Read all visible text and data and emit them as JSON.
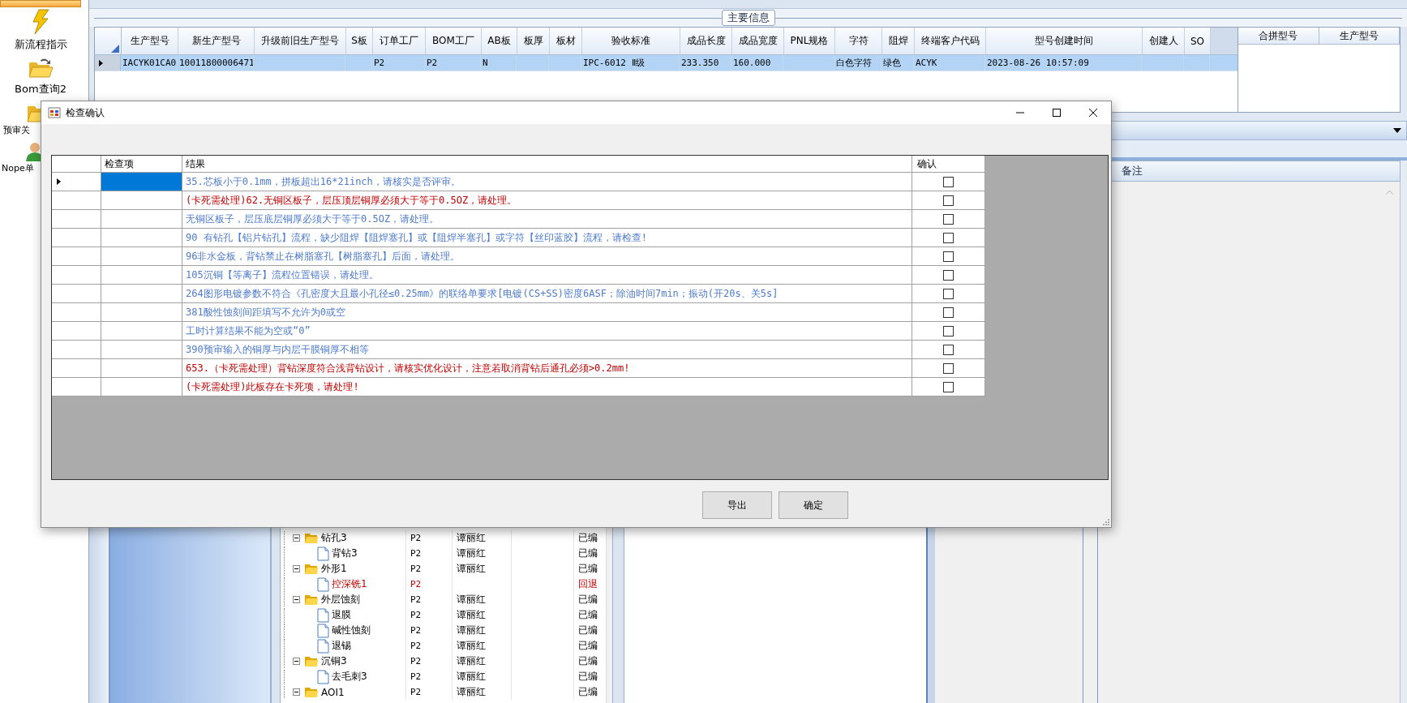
{
  "sidebar": {
    "items": [
      {
        "kind": "lightning",
        "label": "新流程指示"
      },
      {
        "kind": "folder-arrow",
        "label": "Bom查询2"
      },
      {
        "kind": "folder",
        "label": "预审关"
      },
      {
        "kind": "person",
        "label": "Nope单"
      }
    ]
  },
  "main_info": {
    "title": "主要信息",
    "columns": [
      "生产型号",
      "新生产型号",
      "升级前旧生产型号",
      "S板",
      "订单工厂",
      "BOM工厂",
      "AB板",
      "板厚",
      "板材",
      "验收标准",
      "成品长度",
      "成品宽度",
      "PNL规格",
      "字符",
      "阻焊",
      "终端客户代码",
      "型号创建时间",
      "创建人",
      "SO"
    ],
    "rows": [
      {
        "selected": true,
        "cells": [
          "IACYK01CA0",
          "10011800006471",
          null,
          null,
          "P2",
          "P2",
          "N",
          null,
          null,
          "IPC-6012 Ⅱ级",
          "233.350",
          "160.000",
          null,
          "白色字符",
          "绿色",
          "ACYK",
          "2023-08-26 10:57:09",
          null,
          null
        ]
      }
    ]
  },
  "merge_table": {
    "columns": [
      "合拼型号",
      "生产型号"
    ]
  },
  "notes": {
    "title": "备注"
  },
  "tree": [
    {
      "name": "钻孔3",
      "factory": "P2",
      "person": "谭丽红",
      "status": "已编",
      "flagged": false,
      "expanded": true,
      "children": [
        {
          "name": "背钻3",
          "factory": "P2",
          "person": "谭丽红",
          "status": "已编",
          "flagged": false
        }
      ]
    },
    {
      "name": "外形1",
      "factory": "P2",
      "person": "谭丽红",
      "status": "已编",
      "flagged": false,
      "expanded": true,
      "children": [
        {
          "name": "控深铣1",
          "factory": "P2",
          "status": "回退",
          "flagged": true
        }
      ]
    },
    {
      "name": "外层蚀刻",
      "factory": "P2",
      "person": "谭丽红",
      "status": "已编",
      "flagged": false,
      "expanded": true,
      "children": [
        {
          "name": "退膜",
          "factory": "P2",
          "person": "谭丽红",
          "status": "已编",
          "flagged": false
        },
        {
          "name": "碱性蚀刻",
          "factory": "P2",
          "person": "谭丽红",
          "status": "已编",
          "flagged": false
        },
        {
          "name": "退锡",
          "factory": "P2",
          "person": "谭丽红",
          "status": "已编",
          "flagged": false
        }
      ]
    },
    {
      "name": "沉铜3",
      "factory": "P2",
      "person": "谭丽红",
      "status": "已编",
      "flagged": false,
      "expanded": true,
      "children": [
        {
          "name": "去毛刺3",
          "factory": "P2",
          "person": "谭丽红",
          "status": "已编",
          "flagged": false
        }
      ]
    },
    {
      "name": "AOI1",
      "factory": "P2",
      "person": "谭丽红",
      "status": "已编",
      "flagged": false,
      "expanded": true
    }
  ],
  "dialog": {
    "title": "检查确认",
    "columns": [
      "检查项",
      "结果",
      "确认"
    ],
    "rows": [
      {
        "selected": true,
        "color": "#4f7ccc",
        "result": "35.芯板小于0.1mm，拼板超出16*21inch，请核实是否评审。",
        "checked": false
      },
      {
        "selected": false,
        "color": "#c00000",
        "result": "(卡死需处理)62.无铜区板子，层压顶层铜厚必须大于等于0.5OZ，请处理。",
        "checked": false
      },
      {
        "selected": false,
        "color": "#4f7ccc",
        "result": "无铜区板子，层压底层铜厚必须大于等于0.5OZ，请处理。",
        "checked": false
      },
      {
        "selected": false,
        "color": "#4f7ccc",
        "result": "90 有钻孔【铝片钻孔】流程，缺少阻焊【阻焊塞孔】或【阻焊半塞孔】或字符【丝印蓝胶】流程，请检查!",
        "checked": false
      },
      {
        "selected": false,
        "color": "#4f7ccc",
        "result": "96非水金板，背钻禁止在树脂塞孔【树脂塞孔】后面，请处理。",
        "checked": false
      },
      {
        "selected": false,
        "color": "#4f7ccc",
        "result": "105沉铜【等离子】流程位置错误，请处理。",
        "checked": false
      },
      {
        "selected": false,
        "color": "#4f7ccc",
        "result": "264图形电镀参数不符合《孔密度大且最小孔径≤0.25mm》的联络单要求[电镀(CS+SS)密度6ASF；除油时间7min；振动(开20s、关5s]",
        "checked": false
      },
      {
        "selected": false,
        "color": "#4f7ccc",
        "result": "381酸性蚀刻间距填写不允许为0或空",
        "checked": false
      },
      {
        "selected": false,
        "color": "#4f7ccc",
        "result": "工时计算结果不能为空或“0”",
        "checked": false
      },
      {
        "selected": false,
        "color": "#4f7ccc",
        "result": "390预审输入的铜厚与内层干膜铜厚不相等",
        "checked": false
      },
      {
        "selected": false,
        "color": "#c00000",
        "result": "653.（卡死需处理）背钻深度符合浅背钻设计，请核实优化设计，注意若取消背钻后通孔必须>0.2mm!",
        "checked": false
      },
      {
        "selected": false,
        "color": "#c00000",
        "result": "(卡死需处理)此板存在卡死项，请处理!",
        "checked": false
      }
    ],
    "buttons": [
      "导出",
      "确定"
    ]
  }
}
